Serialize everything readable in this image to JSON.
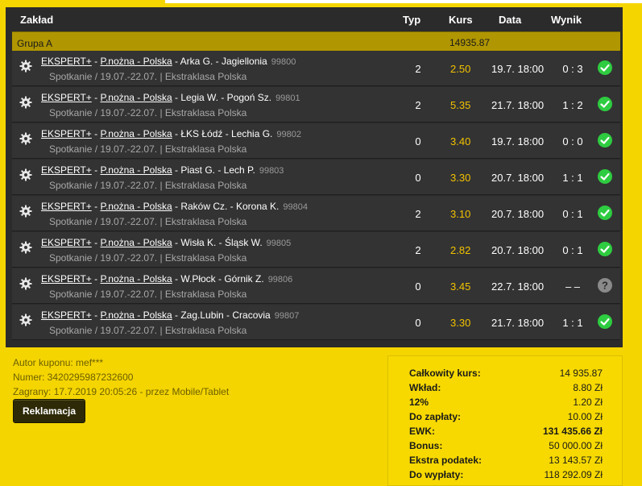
{
  "header": {
    "col_bet": "Zakład",
    "col_type": "Typ",
    "col_odds": "Kurs",
    "col_date": "Data",
    "col_result": "Wynik"
  },
  "group": {
    "name": "Grupa A",
    "value": "14935.87"
  },
  "bets": [
    {
      "prefix": "EKSPERT+",
      "sport": "P.nożna - Polska",
      "match": "Arka G. - Jagiellonia",
      "code": "99800",
      "sub_a": "Spotkanie / 19.07.-22.07.",
      "sub_b": "Ekstraklasa Polska",
      "typ": "2",
      "kurs": "2.50",
      "data": "19.7. 18:00",
      "wynik": "0 : 3",
      "status": "check-circle-icon"
    },
    {
      "prefix": "EKSPERT+",
      "sport": "P.nożna - Polska",
      "match": "Legia W. - Pogoń Sz.",
      "code": "99801",
      "sub_a": "Spotkanie / 19.07.-22.07.",
      "sub_b": "Ekstraklasa Polska",
      "typ": "2",
      "kurs": "5.35",
      "data": "21.7. 18:00",
      "wynik": "1 : 2",
      "status": "check-circle-icon"
    },
    {
      "prefix": "EKSPERT+",
      "sport": "P.nożna - Polska",
      "match": "ŁKS Łódź - Lechia G.",
      "code": "99802",
      "sub_a": "Spotkanie / 19.07.-22.07.",
      "sub_b": "Ekstraklasa Polska",
      "typ": "0",
      "kurs": "3.40",
      "data": "19.7. 18:00",
      "wynik": "0 : 0",
      "status": "check-circle-icon"
    },
    {
      "prefix": "EKSPERT+",
      "sport": "P.nożna - Polska",
      "match": "Piast G. - Lech P.",
      "code": "99803",
      "sub_a": "Spotkanie / 19.07.-22.07.",
      "sub_b": "Ekstraklasa Polska",
      "typ": "0",
      "kurs": "3.30",
      "data": "20.7. 18:00",
      "wynik": "1 : 1",
      "status": "check-circle-icon"
    },
    {
      "prefix": "EKSPERT+",
      "sport": "P.nożna - Polska",
      "match": "Raków Cz. - Korona K.",
      "code": "99804",
      "sub_a": "Spotkanie / 19.07.-22.07.",
      "sub_b": "Ekstraklasa Polska",
      "typ": "2",
      "kurs": "3.10",
      "data": "20.7. 18:00",
      "wynik": "0 : 1",
      "status": "check-circle-icon"
    },
    {
      "prefix": "EKSPERT+",
      "sport": "P.nożna - Polska",
      "match": "Wisła K. - Śląsk W.",
      "code": "99805",
      "sub_a": "Spotkanie / 19.07.-22.07.",
      "sub_b": "Ekstraklasa Polska",
      "typ": "2",
      "kurs": "2.82",
      "data": "20.7. 18:00",
      "wynik": "0 : 1",
      "status": "check-circle-icon"
    },
    {
      "prefix": "EKSPERT+",
      "sport": "P.nożna - Polska",
      "match": "W.Płock - Górnik Z.",
      "code": "99806",
      "sub_a": "Spotkanie / 19.07.-22.07.",
      "sub_b": "Ekstraklasa Polska",
      "typ": "0",
      "kurs": "3.45",
      "data": "22.7. 18:00",
      "wynik": "– –",
      "status": "question-circle-icon"
    },
    {
      "prefix": "EKSPERT+",
      "sport": "P.nożna - Polska",
      "match": "Zag.Lubin - Cracovia",
      "code": "99807",
      "sub_a": "Spotkanie / 19.07.-22.07.",
      "sub_b": "Ekstraklasa Polska",
      "typ": "0",
      "kurs": "3.30",
      "data": "21.7. 18:00",
      "wynik": "1 : 1",
      "status": "check-circle-icon"
    }
  ],
  "coupon": {
    "author": "Autor kuponu: mef***",
    "number": "Numer: 3420295987232600",
    "played": "Zagrany: 17.7.2019 20:05:26 - przez Mobile/Tablet",
    "complaint_button": "Reklamacja"
  },
  "summary": {
    "rows": [
      {
        "label": "Całkowity kurs:",
        "value": "14 935.87",
        "bold": false
      },
      {
        "label": "Wkład:",
        "value": "8.80 Zł",
        "bold": false
      },
      {
        "label": "12%",
        "value": "1.20 Zł",
        "bold": false
      },
      {
        "label": "Do zapłaty:",
        "value": "10.00 Zł",
        "bold": false
      },
      {
        "label": "EWK:",
        "value": "131 435.66 Zł",
        "bold": true
      },
      {
        "label": "Bonus:",
        "value": "50 000.00 Zł",
        "bold": false
      },
      {
        "label": "Ekstra podatek:",
        "value": "13 143.57 Zł",
        "bold": false
      },
      {
        "label": "Do wypłaty:",
        "value": "118 292.09 Zł",
        "bold": false
      }
    ]
  },
  "colors": {
    "background": "#f5d500",
    "panel": "#2b2b2b",
    "row": "#333333",
    "group": "#b09600",
    "odds": "#f2c200",
    "win": "#2ecc40",
    "pending": "#8a8a8a"
  }
}
